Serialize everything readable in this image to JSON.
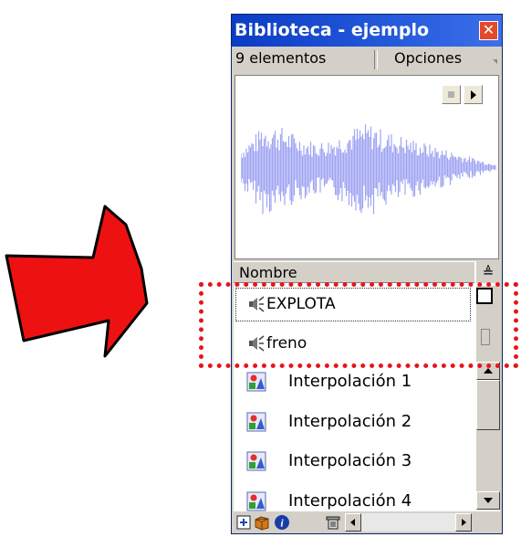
{
  "window": {
    "title": "Biblioteca - ejemplo",
    "close_glyph": "✕"
  },
  "toolbar": {
    "count_label": "9 elementos",
    "options_label": "Opciones"
  },
  "list": {
    "column_header": "Nombre",
    "sort_glyph": "≜",
    "items": [
      {
        "label": "EXPLOTA",
        "icon": "sound-icon",
        "selected": true
      },
      {
        "label": "freno",
        "icon": "sound-icon",
        "selected": false
      },
      {
        "label": "Interpolación 1",
        "icon": "graphic-symbol-icon"
      },
      {
        "label": "Interpolación 2",
        "icon": "graphic-symbol-icon"
      },
      {
        "label": "Interpolación 3",
        "icon": "graphic-symbol-icon"
      },
      {
        "label": "Interpolación 4",
        "icon": "graphic-symbol-icon"
      }
    ]
  },
  "colors": {
    "titlebar": "#0a3cc4",
    "waveform": "#9fa4f2",
    "highlight": "#e8141c",
    "arrow_fill": "#ee1111"
  },
  "icons": {
    "arrow": "red-arrow-right",
    "bottom": [
      "new-symbol-icon",
      "new-folder-icon",
      "properties-icon",
      "trash-icon"
    ]
  }
}
